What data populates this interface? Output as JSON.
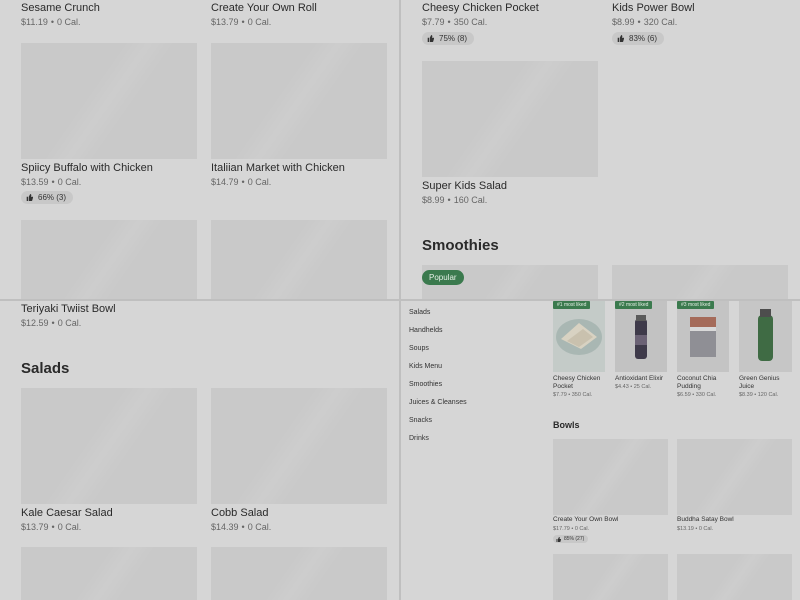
{
  "q1": {
    "items": [
      {
        "name": "Sesame Crunch",
        "price": "$11.19",
        "cal": "0 Cal."
      },
      {
        "name": "Create Your Own Roll",
        "price": "$13.79",
        "cal": "0 Cal."
      },
      {
        "name": "Spiicy Buffalo with Chicken",
        "price": "$13.59",
        "cal": "0 Cal.",
        "rating": "66% (3)"
      },
      {
        "name": "Italiian Market with Chicken",
        "price": "$14.79",
        "cal": "0 Cal."
      }
    ]
  },
  "q2": {
    "items": [
      {
        "name": "Cheesy Chicken Pocket",
        "price": "$7.79",
        "cal": "350 Cal.",
        "rating": "75% (8)"
      },
      {
        "name": "Kids Power Bowl",
        "price": "$8.99",
        "cal": "320 Cal.",
        "rating": "83% (6)"
      },
      {
        "name": "Super Kids Salad",
        "price": "$8.99",
        "cal": "160 Cal."
      }
    ],
    "section": "Smoothies",
    "popular_badge": "Popular"
  },
  "q3": {
    "items": [
      {
        "name": "Teriyaki Twiist Bowl",
        "price": "$12.59",
        "cal": "0 Cal."
      },
      {
        "name": "Kale Caesar Salad",
        "price": "$13.79",
        "cal": "0 Cal."
      },
      {
        "name": "Cobb Salad",
        "price": "$14.39",
        "cal": "0 Cal."
      }
    ],
    "section": "Salads"
  },
  "q4": {
    "nav": [
      "Salads",
      "Handhelds",
      "Soups",
      "Kids Menu",
      "Smoothies",
      "Juices & Cleanses",
      "Snacks",
      "Drinks"
    ],
    "most_liked": [
      {
        "tag": "#1 most liked",
        "name": "Cheesy Chicken Pocket",
        "price": "$7.79",
        "cal": "350 Cal."
      },
      {
        "tag": "#2 most liked",
        "name": "Antioxidant Elixir",
        "price": "$4.43",
        "cal": "25 Cal."
      },
      {
        "tag": "#3 most liked",
        "name": "Coconut Chia Pudding",
        "price": "$6.59",
        "cal": "330 Cal."
      },
      {
        "tag": "",
        "name": "Green Genius Juice",
        "price": "$8.39",
        "cal": "120 Cal."
      }
    ],
    "section": "Bowls",
    "bowls": [
      {
        "name": "Create Your Own Bowl",
        "price": "$17.79",
        "cal": "0 Cal.",
        "rating": "85% (27)"
      },
      {
        "name": "Buddha Satay Bowl",
        "price": "$13.19",
        "cal": "0 Cal."
      }
    ]
  },
  "colors": {
    "accent_green": "#3b7a4e",
    "overlay": "#d6d6d6",
    "placeholder": "#c9c9c9"
  }
}
